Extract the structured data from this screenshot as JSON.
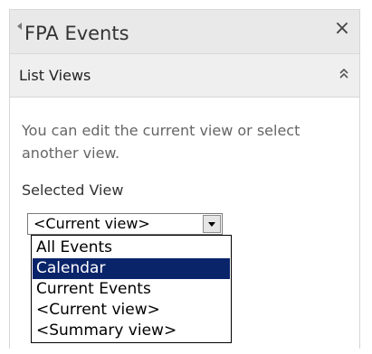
{
  "panel": {
    "title": "FPA Events"
  },
  "section": {
    "title": "List Views"
  },
  "description": "You can edit the current view or select another view.",
  "selected_view": {
    "label": "Selected View",
    "value": "<Current view>",
    "options": [
      "All Events",
      "Calendar",
      "Current Events",
      "<Current view>",
      "<Summary view>"
    ],
    "highlighted_option": "Calendar"
  },
  "icons": {
    "back": "back-arrow-icon",
    "close": "close-icon",
    "collapse": "collapse-chevrons-icon",
    "dropdown": "dropdown-arrow-icon"
  },
  "colors": {
    "header_bg": "#e9e9e9",
    "section_bg": "#efefef",
    "highlight": "#0a246a"
  }
}
